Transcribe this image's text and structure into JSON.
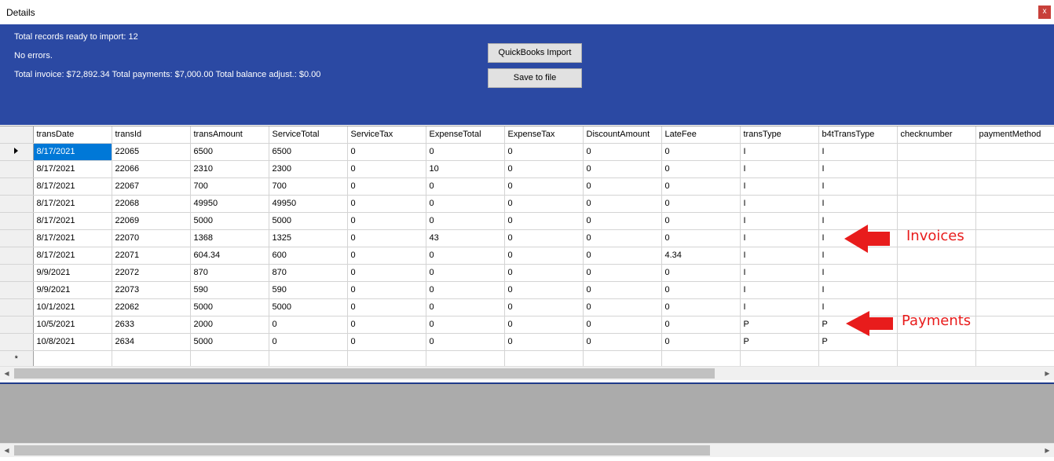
{
  "window": {
    "title": "Details",
    "close_label": "x"
  },
  "summary": {
    "records_line": "Total records ready to import: 12",
    "errors_line": "No errors.",
    "totals_line": "Total invoice: $72,892.34 Total payments: $7,000.00 Total balance adjust.: $0.00"
  },
  "buttons": {
    "import_label": "QuickBooks Import",
    "save_label": "Save to file"
  },
  "grid": {
    "columns": [
      "transDate",
      "transId",
      "transAmount",
      "ServiceTotal",
      "ServiceTax",
      "ExpenseTotal",
      "ExpenseTax",
      "DiscountAmount",
      "LateFee",
      "transType",
      "b4tTransType",
      "checknumber",
      "paymentMethod"
    ],
    "rows": [
      [
        "8/17/2021",
        "22065",
        "6500",
        "6500",
        "0",
        "0",
        "0",
        "0",
        "0",
        "I",
        "I",
        "",
        ""
      ],
      [
        "8/17/2021",
        "22066",
        "2310",
        "2300",
        "0",
        "10",
        "0",
        "0",
        "0",
        "I",
        "I",
        "",
        ""
      ],
      [
        "8/17/2021",
        "22067",
        "700",
        "700",
        "0",
        "0",
        "0",
        "0",
        "0",
        "I",
        "I",
        "",
        ""
      ],
      [
        "8/17/2021",
        "22068",
        "49950",
        "49950",
        "0",
        "0",
        "0",
        "0",
        "0",
        "I",
        "I",
        "",
        ""
      ],
      [
        "8/17/2021",
        "22069",
        "5000",
        "5000",
        "0",
        "0",
        "0",
        "0",
        "0",
        "I",
        "I",
        "",
        ""
      ],
      [
        "8/17/2021",
        "22070",
        "1368",
        "1325",
        "0",
        "43",
        "0",
        "0",
        "0",
        "I",
        "I",
        "",
        ""
      ],
      [
        "8/17/2021",
        "22071",
        "604.34",
        "600",
        "0",
        "0",
        "0",
        "0",
        "4.34",
        "I",
        "I",
        "",
        ""
      ],
      [
        "9/9/2021",
        "22072",
        "870",
        "870",
        "0",
        "0",
        "0",
        "0",
        "0",
        "I",
        "I",
        "",
        ""
      ],
      [
        "9/9/2021",
        "22073",
        "590",
        "590",
        "0",
        "0",
        "0",
        "0",
        "0",
        "I",
        "I",
        "",
        ""
      ],
      [
        "10/1/2021",
        "22062",
        "5000",
        "5000",
        "0",
        "0",
        "0",
        "0",
        "0",
        "I",
        "I",
        "",
        ""
      ],
      [
        "10/5/2021",
        "2633",
        "2000",
        "0",
        "0",
        "0",
        "0",
        "0",
        "0",
        "P",
        "P",
        "",
        ""
      ],
      [
        "10/8/2021",
        "2634",
        "5000",
        "0",
        "0",
        "0",
        "0",
        "0",
        "0",
        "P",
        "P",
        "",
        ""
      ]
    ],
    "new_row_marker": "*"
  },
  "annotations": {
    "invoices": "Invoices",
    "payments": "Payments"
  },
  "colors": {
    "header_bg": "#2b49a3",
    "selection": "#0078d7",
    "annotation": "#e81c1c"
  }
}
